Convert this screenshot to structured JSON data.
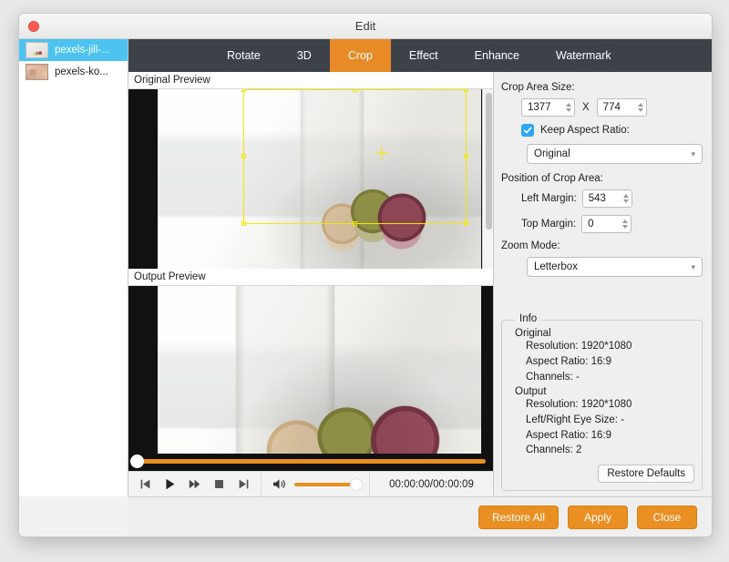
{
  "window": {
    "title": "Edit",
    "close_icon": "close-traffic-light"
  },
  "sidebar": {
    "items": [
      {
        "label": "pexels-jill-...",
        "selected": true
      },
      {
        "label": "pexels-ko...",
        "selected": false
      }
    ]
  },
  "tabs": [
    {
      "label": "Rotate",
      "active": false
    },
    {
      "label": "3D",
      "active": false
    },
    {
      "label": "Crop",
      "active": true
    },
    {
      "label": "Effect",
      "active": false
    },
    {
      "label": "Enhance",
      "active": false
    },
    {
      "label": "Watermark",
      "active": false
    }
  ],
  "previews": {
    "original_header": "Original Preview",
    "output_header": "Output Preview",
    "crop_overlay_color": "#f5e800"
  },
  "player": {
    "buttons": [
      "previous-icon",
      "play-icon",
      "fast-forward-icon",
      "stop-icon",
      "next-icon"
    ],
    "volume_icon": "volume-icon",
    "timecode": "00:00:00/00:00:09",
    "progress_color": "#e8901f"
  },
  "panel": {
    "crop_area_size_label": "Crop Area Size:",
    "width_value": "1377",
    "x_separator": "X",
    "height_value": "774",
    "keep_aspect_label": "Keep Aspect Ratio:",
    "keep_aspect_checked": true,
    "aspect_select_value": "Original",
    "position_label": "Position of Crop Area:",
    "left_margin_label": "Left Margin:",
    "left_margin_value": "543",
    "top_margin_label": "Top Margin:",
    "top_margin_value": "0",
    "zoom_mode_label": "Zoom Mode:",
    "zoom_mode_value": "Letterbox",
    "restore_defaults_label": "Restore Defaults"
  },
  "info": {
    "legend": "Info",
    "original_title": "Original",
    "original_lines": [
      "Resolution: 1920*1080",
      "Aspect Ratio: 16:9",
      "Channels: -"
    ],
    "output_title": "Output",
    "output_lines": [
      "Resolution: 1920*1080",
      "Left/Right Eye Size: -",
      "Aspect Ratio: 16:9",
      "Channels: 2"
    ]
  },
  "footer": {
    "restore_all_label": "Restore All",
    "apply_label": "Apply",
    "close_label": "Close",
    "accent_color": "#ea8f22"
  }
}
